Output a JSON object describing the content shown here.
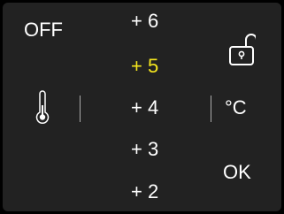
{
  "status": {
    "off_label": "OFF"
  },
  "wheel": {
    "values": [
      "+ 6",
      "+ 5",
      "+ 4",
      "+ 3",
      "+ 2"
    ],
    "selected_index": 1,
    "selected_color": "#f5e61e"
  },
  "unit": {
    "label": "°C"
  },
  "actions": {
    "ok_label": "OK"
  },
  "icons": {
    "left": "thermometer-icon",
    "top_right": "unlock-icon"
  },
  "colors": {
    "background": "#222222",
    "text": "#ffffff"
  }
}
